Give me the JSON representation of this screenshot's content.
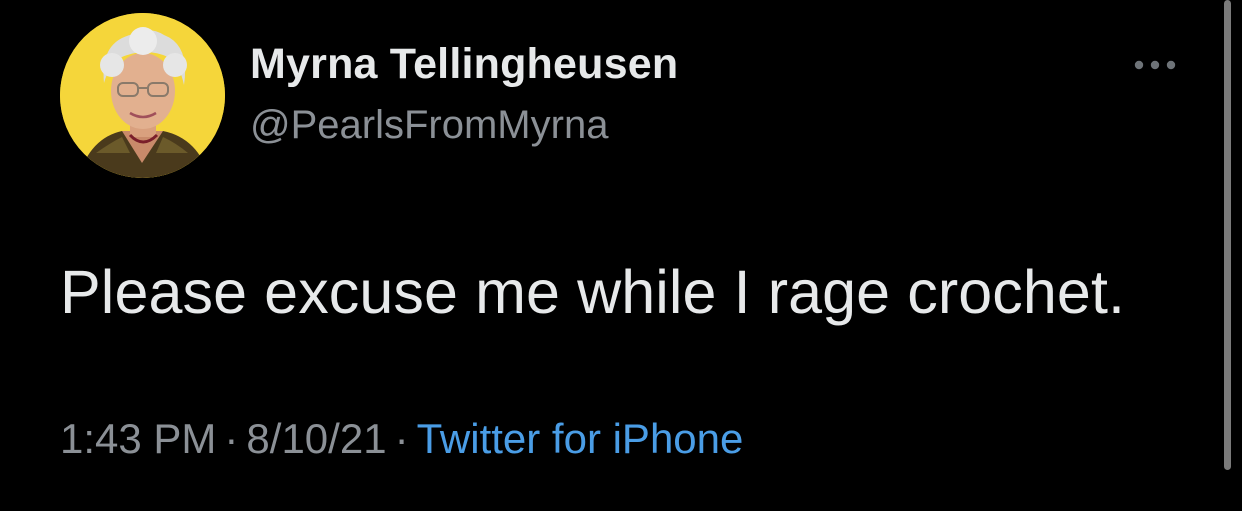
{
  "tweet": {
    "author": {
      "display_name": "Myrna Tellingheusen",
      "handle": "@PearlsFromMyrna",
      "avatar_icon": "user-avatar-photo",
      "avatar_bg_color": "#f5d63a"
    },
    "more_icon": "more-dots-icon",
    "text": "Please excuse me while I rage crochet.",
    "meta": {
      "time": "1:43 PM",
      "date": "8/10/21",
      "separator": "·",
      "source": "Twitter for iPhone"
    }
  },
  "colors": {
    "background": "#000000",
    "primary_text": "#e7e9ea",
    "secondary_text": "#8b9096",
    "link": "#4a9de6"
  }
}
